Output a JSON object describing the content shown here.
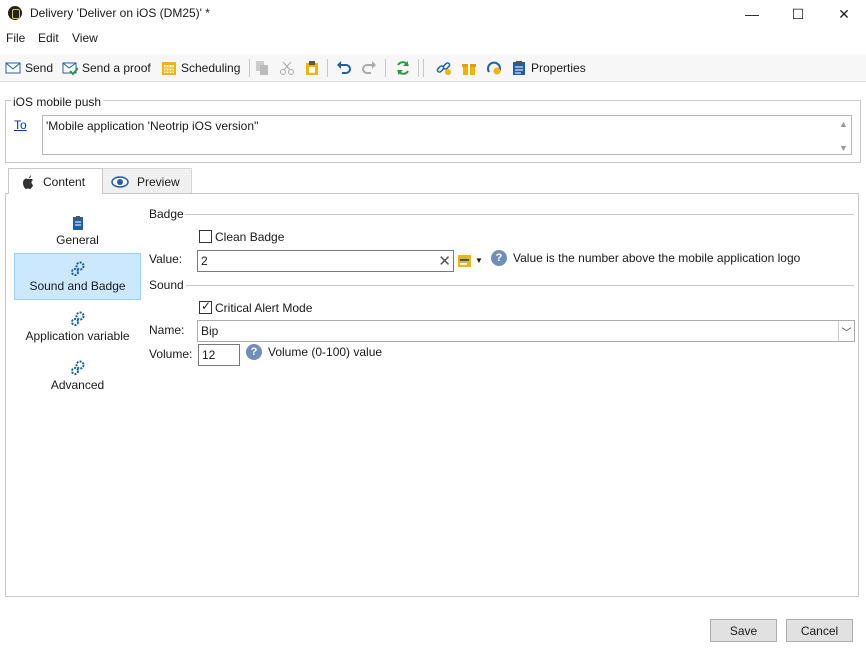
{
  "window": {
    "title": "Delivery 'Deliver on iOS (DM25)' *",
    "controls": [
      "—",
      "☐",
      "✕"
    ]
  },
  "menu": {
    "file": "File",
    "edit": "Edit",
    "view": "View"
  },
  "toolbar": {
    "send": "Send",
    "send_proof": "Send a proof",
    "scheduling": "Scheduling",
    "properties": "Properties"
  },
  "recipients": {
    "group_title": "iOS mobile push",
    "to_link": "To",
    "to_value": "'Mobile application 'Neotrip iOS version''"
  },
  "tabs": {
    "content": "Content",
    "preview": "Preview"
  },
  "sidebar": {
    "items": [
      {
        "label": "General",
        "active": false
      },
      {
        "label": "Sound and Badge",
        "active": true
      },
      {
        "label": "Application variable",
        "active": false
      },
      {
        "label": "Advanced",
        "active": false
      }
    ]
  },
  "badge": {
    "section": "Badge",
    "clean_label": "Clean Badge",
    "clean_checked": false,
    "value_label": "Value:",
    "value": "2",
    "help": "Value is the number above the mobile application logo"
  },
  "sound": {
    "section": "Sound",
    "critical_label": "Critical Alert Mode",
    "critical_checked": true,
    "name_label": "Name:",
    "name_value": "Bip",
    "volume_label": "Volume:",
    "volume_value": "12",
    "volume_help": "Volume (0-100) value"
  },
  "footer": {
    "save": "Save",
    "cancel": "Cancel"
  },
  "colors": {
    "accent_selection": "#cce8ff",
    "link": "#0033cc",
    "help": "#6f8fb8",
    "icon_blue": "#1f5fa8",
    "icon_yellow": "#f2b400",
    "icon_green": "#2e9a3a"
  }
}
